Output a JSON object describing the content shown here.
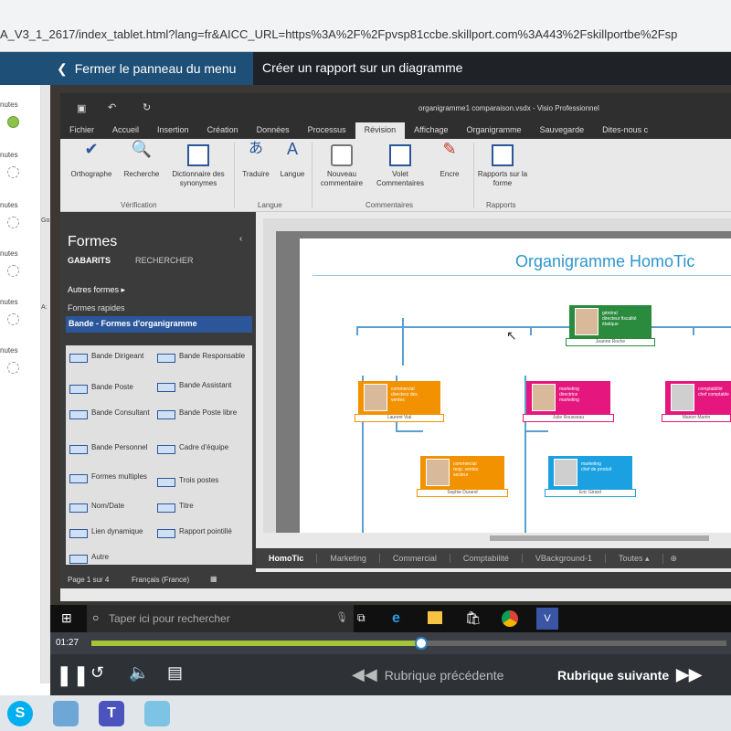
{
  "browser": {
    "url": "A_V3_1_2617/index_tablet.html?lang=fr&AICC_URL=https%3A%2F%2Fpvsp81ccbe.skillport.com%3A443%2Fskillportbe%2Fsp"
  },
  "menubar": {
    "close_label": "Fermer le panneau du menu",
    "lesson_title": "Créer un rapport sur un diagramme"
  },
  "leftpanel": {
    "items": [
      "nutes",
      "nutes",
      "nutes",
      "nutes",
      "nutes",
      "nutes"
    ],
    "side_labels": [
      "Go",
      "A:"
    ]
  },
  "visio": {
    "window_title": "organigramme1 comparaison.vsdx - Visio Professionnel",
    "tabs": [
      "Fichier",
      "Accueil",
      "Insertion",
      "Création",
      "Données",
      "Processus",
      "Révision",
      "Affichage",
      "Organigramme",
      "Sauvegarde"
    ],
    "tell_me": "Dites-nous c",
    "ribbon": {
      "orthographe": "Orthographe",
      "recherche": "Recherche",
      "dictionnaire": "Dictionnaire des synonymes",
      "traduire": "Traduire",
      "langue": "Langue",
      "nouveau_commentaire": "Nouveau commentaire",
      "volet_commentaires": "Volet Commentaires",
      "encre": "Encre",
      "rapports": "Rapports sur la forme",
      "groups": [
        "Vérification",
        "Langue",
        "Commentaires",
        "Rapports"
      ]
    },
    "shapes": {
      "title": "Formes",
      "tab_gabarits": "GABARITS",
      "tab_rechercher": "RECHERCHER",
      "autres_formes": "Autres formes",
      "formes_rapides": "Formes rapides",
      "selected_stencil": "Bande - Formes d'organigramme",
      "items": [
        "Bande Dirigeant",
        "Bande Responsable",
        "Bande Poste",
        "Bande Assistant",
        "Bande Consultant",
        "Bande Poste libre",
        "Bande Personnel",
        "Cadre d'équipe",
        "Formes multiples",
        "Trois postes",
        "Nom/Date",
        "Titre",
        "Lien dynamique",
        "Rapport pointillé",
        "Autre"
      ]
    },
    "org_title": "Organigramme HomoTic",
    "page_tabs": [
      "HomoTic",
      "Marketing",
      "Commercial",
      "Comptabilité",
      "VBackground-1",
      "Toutes ▴"
    ],
    "status": {
      "page": "Page 1 sur 4",
      "language": "Français (France)"
    },
    "cards": [
      {
        "color": "#2a8a3e",
        "text": "général\ndirecteur fiscalité\nétatique",
        "name": "Jeanne Roche"
      },
      {
        "color": "#f39200",
        "text": "commercial\ndirecteur des\nventes",
        "name": "Laurent Vial"
      },
      {
        "color": "#e5167d",
        "text": "marketing\ndirectrice\nmarketing",
        "name": "Julie Rousseau"
      },
      {
        "color": "#e5167d",
        "text": "comptabilité\nchef comptable",
        "name": "Manon Martin"
      },
      {
        "color": "#f39200",
        "text": "commercial\nresp. ventes\nsecteur",
        "name": "Sophie Durand"
      },
      {
        "color": "#1ba1e2",
        "text": "marketing\nchef de produit",
        "name": "Eric Girard"
      }
    ]
  },
  "win_taskbar": {
    "search_placeholder": "Taper ici pour rechercher"
  },
  "player": {
    "time": "01:27",
    "progress": 0.52,
    "prev_label": "Rubrique précédente",
    "next_label": "Rubrique suivante"
  },
  "colors": {
    "accent": "#1d4f77",
    "progress": "#a4c639"
  }
}
